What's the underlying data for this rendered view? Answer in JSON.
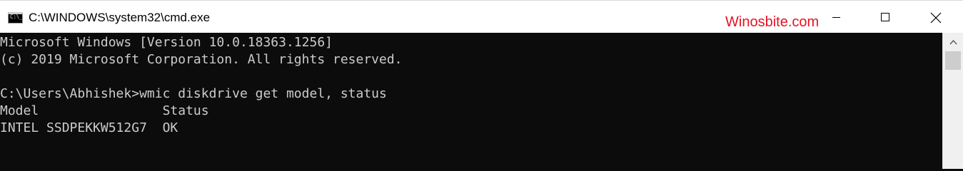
{
  "window": {
    "title": "C:\\WINDOWS\\system32\\cmd.exe",
    "watermark": "Winosbite.com",
    "icon_prompt": "C:\\_"
  },
  "controls": {
    "minimize": "minimize",
    "maximize": "maximize",
    "close": "close"
  },
  "console": {
    "lines": [
      "Microsoft Windows [Version 10.0.18363.1256]",
      "(c) 2019 Microsoft Corporation. All rights reserved.",
      "",
      "C:\\Users\\Abhishek>wmic diskdrive get model, status",
      "Model                Status",
      "INTEL SSDPEKKW512G7  OK"
    ]
  },
  "colors": {
    "console_bg": "#0c0c0c",
    "console_text": "#cccccc",
    "titlebar_bg": "#ffffff",
    "watermark": "#e81123"
  },
  "icons": {
    "app_icon": "cmd-icon",
    "minimize": "minimize-icon",
    "maximize": "maximize-icon",
    "close": "close-icon",
    "scroll_up": "chevron-up-icon"
  }
}
